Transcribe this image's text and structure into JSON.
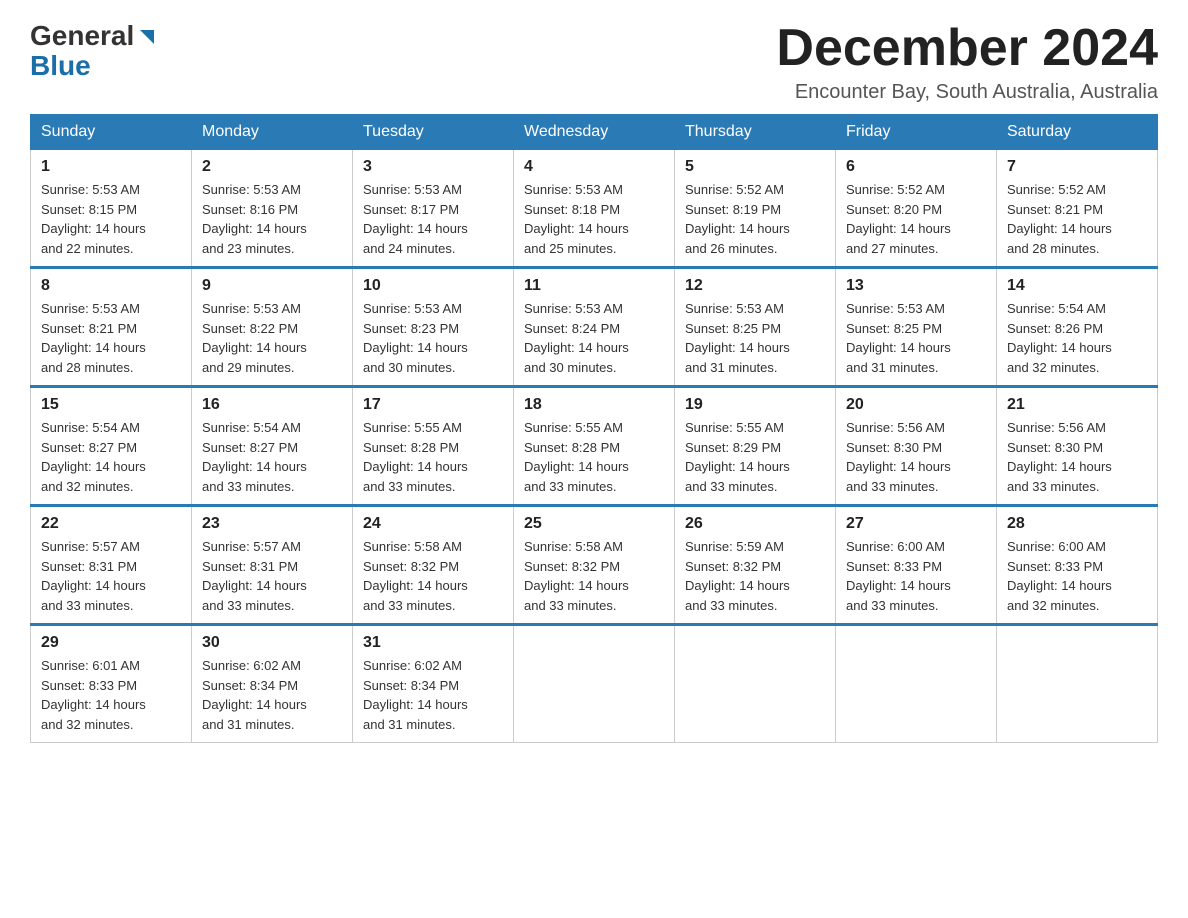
{
  "header": {
    "logo_general": "General",
    "logo_blue": "Blue",
    "month_title": "December 2024",
    "location": "Encounter Bay, South Australia, Australia"
  },
  "weekdays": [
    "Sunday",
    "Monday",
    "Tuesday",
    "Wednesday",
    "Thursday",
    "Friday",
    "Saturday"
  ],
  "weeks": [
    {
      "days": [
        {
          "num": "1",
          "sunrise": "5:53 AM",
          "sunset": "8:15 PM",
          "daylight": "14 hours and 22 minutes."
        },
        {
          "num": "2",
          "sunrise": "5:53 AM",
          "sunset": "8:16 PM",
          "daylight": "14 hours and 23 minutes."
        },
        {
          "num": "3",
          "sunrise": "5:53 AM",
          "sunset": "8:17 PM",
          "daylight": "14 hours and 24 minutes."
        },
        {
          "num": "4",
          "sunrise": "5:53 AM",
          "sunset": "8:18 PM",
          "daylight": "14 hours and 25 minutes."
        },
        {
          "num": "5",
          "sunrise": "5:52 AM",
          "sunset": "8:19 PM",
          "daylight": "14 hours and 26 minutes."
        },
        {
          "num": "6",
          "sunrise": "5:52 AM",
          "sunset": "8:20 PM",
          "daylight": "14 hours and 27 minutes."
        },
        {
          "num": "7",
          "sunrise": "5:52 AM",
          "sunset": "8:21 PM",
          "daylight": "14 hours and 28 minutes."
        }
      ]
    },
    {
      "days": [
        {
          "num": "8",
          "sunrise": "5:53 AM",
          "sunset": "8:21 PM",
          "daylight": "14 hours and 28 minutes."
        },
        {
          "num": "9",
          "sunrise": "5:53 AM",
          "sunset": "8:22 PM",
          "daylight": "14 hours and 29 minutes."
        },
        {
          "num": "10",
          "sunrise": "5:53 AM",
          "sunset": "8:23 PM",
          "daylight": "14 hours and 30 minutes."
        },
        {
          "num": "11",
          "sunrise": "5:53 AM",
          "sunset": "8:24 PM",
          "daylight": "14 hours and 30 minutes."
        },
        {
          "num": "12",
          "sunrise": "5:53 AM",
          "sunset": "8:25 PM",
          "daylight": "14 hours and 31 minutes."
        },
        {
          "num": "13",
          "sunrise": "5:53 AM",
          "sunset": "8:25 PM",
          "daylight": "14 hours and 31 minutes."
        },
        {
          "num": "14",
          "sunrise": "5:54 AM",
          "sunset": "8:26 PM",
          "daylight": "14 hours and 32 minutes."
        }
      ]
    },
    {
      "days": [
        {
          "num": "15",
          "sunrise": "5:54 AM",
          "sunset": "8:27 PM",
          "daylight": "14 hours and 32 minutes."
        },
        {
          "num": "16",
          "sunrise": "5:54 AM",
          "sunset": "8:27 PM",
          "daylight": "14 hours and 33 minutes."
        },
        {
          "num": "17",
          "sunrise": "5:55 AM",
          "sunset": "8:28 PM",
          "daylight": "14 hours and 33 minutes."
        },
        {
          "num": "18",
          "sunrise": "5:55 AM",
          "sunset": "8:28 PM",
          "daylight": "14 hours and 33 minutes."
        },
        {
          "num": "19",
          "sunrise": "5:55 AM",
          "sunset": "8:29 PM",
          "daylight": "14 hours and 33 minutes."
        },
        {
          "num": "20",
          "sunrise": "5:56 AM",
          "sunset": "8:30 PM",
          "daylight": "14 hours and 33 minutes."
        },
        {
          "num": "21",
          "sunrise": "5:56 AM",
          "sunset": "8:30 PM",
          "daylight": "14 hours and 33 minutes."
        }
      ]
    },
    {
      "days": [
        {
          "num": "22",
          "sunrise": "5:57 AM",
          "sunset": "8:31 PM",
          "daylight": "14 hours and 33 minutes."
        },
        {
          "num": "23",
          "sunrise": "5:57 AM",
          "sunset": "8:31 PM",
          "daylight": "14 hours and 33 minutes."
        },
        {
          "num": "24",
          "sunrise": "5:58 AM",
          "sunset": "8:32 PM",
          "daylight": "14 hours and 33 minutes."
        },
        {
          "num": "25",
          "sunrise": "5:58 AM",
          "sunset": "8:32 PM",
          "daylight": "14 hours and 33 minutes."
        },
        {
          "num": "26",
          "sunrise": "5:59 AM",
          "sunset": "8:32 PM",
          "daylight": "14 hours and 33 minutes."
        },
        {
          "num": "27",
          "sunrise": "6:00 AM",
          "sunset": "8:33 PM",
          "daylight": "14 hours and 33 minutes."
        },
        {
          "num": "28",
          "sunrise": "6:00 AM",
          "sunset": "8:33 PM",
          "daylight": "14 hours and 32 minutes."
        }
      ]
    },
    {
      "days": [
        {
          "num": "29",
          "sunrise": "6:01 AM",
          "sunset": "8:33 PM",
          "daylight": "14 hours and 32 minutes."
        },
        {
          "num": "30",
          "sunrise": "6:02 AM",
          "sunset": "8:34 PM",
          "daylight": "14 hours and 31 minutes."
        },
        {
          "num": "31",
          "sunrise": "6:02 AM",
          "sunset": "8:34 PM",
          "daylight": "14 hours and 31 minutes."
        },
        null,
        null,
        null,
        null
      ]
    }
  ],
  "labels": {
    "sunrise": "Sunrise:",
    "sunset": "Sunset:",
    "daylight": "Daylight:"
  }
}
